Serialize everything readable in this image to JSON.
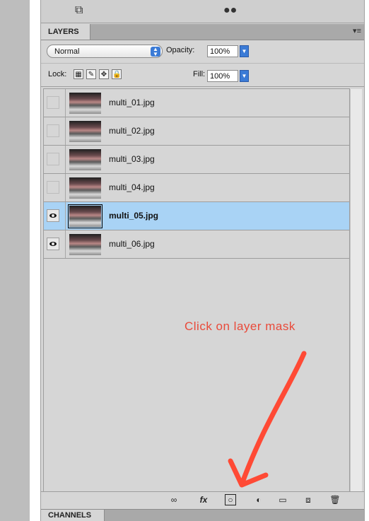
{
  "top_strip": {
    "left_icon": "layer-comp-icon",
    "right_icon": "paths-icon"
  },
  "layers_panel": {
    "tab_label": "LAYERS",
    "menu_icon": "panel-menu-icon",
    "blend_mode": "Normal",
    "opacity_label": "Opacity:",
    "opacity_value": "100%",
    "lock_label": "Lock:",
    "fill_label": "Fill:",
    "fill_value": "100%",
    "layers": [
      {
        "name": "multi_01.jpg",
        "visible": false,
        "selected": false
      },
      {
        "name": "multi_02.jpg",
        "visible": false,
        "selected": false
      },
      {
        "name": "multi_03.jpg",
        "visible": false,
        "selected": false
      },
      {
        "name": "multi_04.jpg",
        "visible": false,
        "selected": false
      },
      {
        "name": "multi_05.jpg",
        "visible": true,
        "selected": true
      },
      {
        "name": "multi_06.jpg",
        "visible": true,
        "selected": false
      }
    ],
    "annotation": "Click on layer mask",
    "annotation_color": "#e94a3a",
    "selection_color": "#a9d3f5",
    "bottom_icons": [
      "link-icon",
      "fx-icon",
      "layer-mask-icon",
      "adjustment-icon",
      "group-folder-icon",
      "new-layer-icon",
      "trash-icon"
    ]
  },
  "channels_panel": {
    "tab_label": "CHANNELS"
  }
}
